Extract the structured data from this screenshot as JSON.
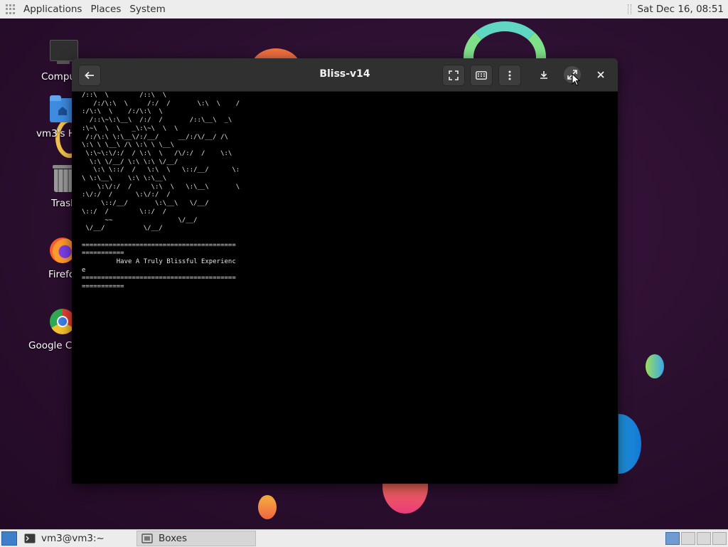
{
  "top_panel": {
    "menus": [
      "Applications",
      "Places",
      "System"
    ],
    "clock": "Sat Dec 16, 08:51"
  },
  "desktop_icons": [
    {
      "label": "Compu",
      "icon": "computer-icon"
    },
    {
      "label": "vm3's Ho",
      "icon": "home-folder-icon"
    },
    {
      "label": "Trash",
      "icon": "trash-icon"
    },
    {
      "label": "Firefo",
      "icon": "firefox-icon"
    },
    {
      "label": "Google Ch",
      "icon": "chrome-icon"
    }
  ],
  "window": {
    "title": "Bliss-v14",
    "buttons": {
      "back": "back-arrow-icon",
      "fullscreen": "fullscreen-icon",
      "keyboard": "keyboard-icon",
      "menu": "menu-dots-icon",
      "download": "download-icon",
      "resize": "resize-icon",
      "close": "close-icon"
    },
    "console_text": "/::\\  \\        /::\\  \\\n   /:/\\:\\  \\     /:/  /       \\:\\  \\    /\n:/\\:\\  \\    /:/\\:\\  \\\n  /::\\~\\:\\__\\  /:/  /       /::\\__\\  _\\\n:\\~\\  \\  \\   _\\:\\~\\  \\  \\\n /:/\\:\\ \\:\\__\\/:/__/     __/:/\\/__/ /\\\n\\:\\ \\ \\__\\ /\\ \\:\\ \\ \\__\\\n \\:\\~\\:\\/:/  / \\:\\  \\   /\\/:/  /    \\:\\\n  \\:\\ \\/__/ \\:\\ \\:\\ \\/__/\n   \\:\\ \\::/  /   \\:\\  \\   \\::/__/      \\:\n\\ \\:\\__\\    \\:\\ \\:\\__\\\n    \\:\\/:/  /     \\:\\  \\   \\:\\__\\       \\\n:\\/:/  /      \\:\\/:/  /\n     \\::/__/       \\:\\__\\   \\/__/\n\\::/  /        \\::/  /\n      ~~                 \\/__/\n \\/__/          \\/__/\n\n========================================\n===========\n         Have A Truly Blissful Experienc\ne\n========================================\n==========="
  },
  "taskbar": {
    "tasks": [
      {
        "label": "vm3@vm3:~",
        "icon": "terminal-icon"
      },
      {
        "label": "Boxes",
        "icon": "boxes-icon"
      }
    ]
  }
}
